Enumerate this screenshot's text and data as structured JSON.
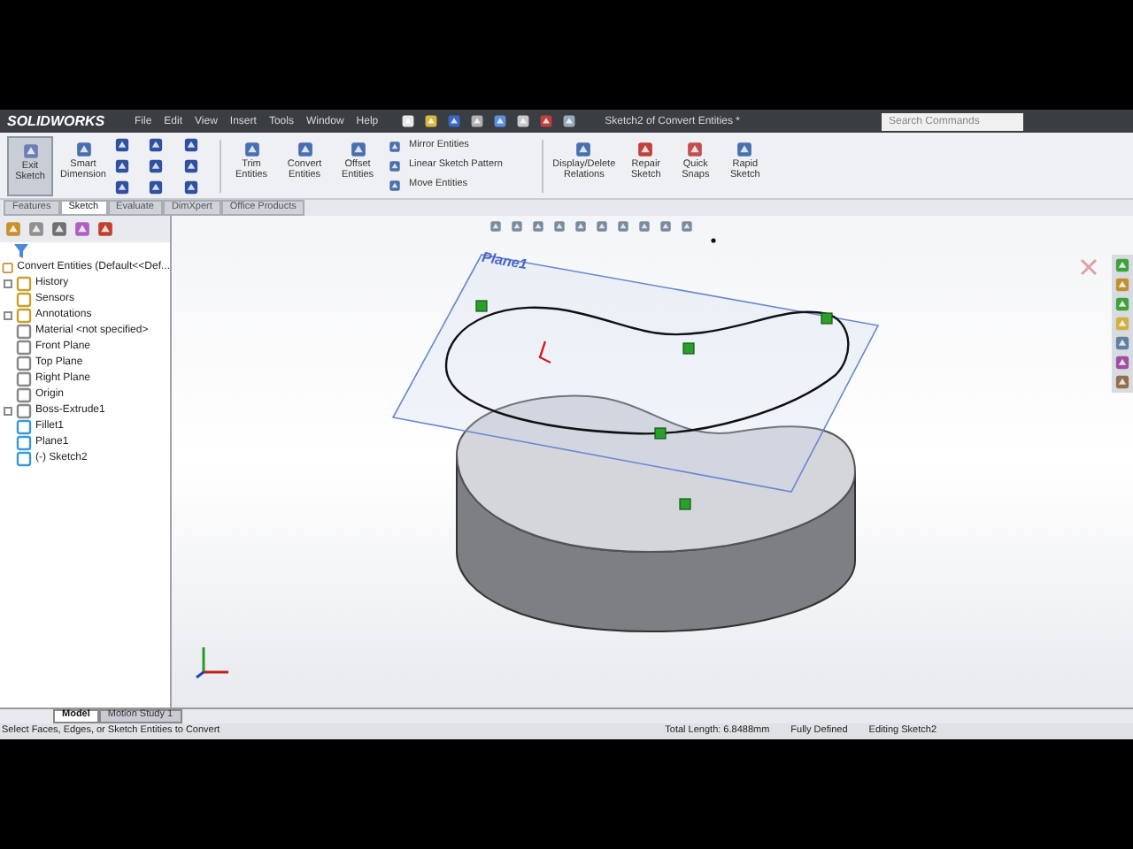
{
  "title_bar": {
    "logo": "SOLIDWORKS",
    "menu": [
      "File",
      "Edit",
      "View",
      "Insert",
      "Tools",
      "Window",
      "Help"
    ],
    "document_title": "Sketch2 of Convert Entities *",
    "search": {
      "placeholder": "Search Commands"
    }
  },
  "ribbon": {
    "large_tools": [
      {
        "label": "Exit Sketch",
        "selected": true
      },
      {
        "label": "Smart Dimension",
        "selected": false
      },
      {
        "label": "Trim Entities",
        "selected": false
      },
      {
        "label": "Convert Entities",
        "selected": false
      },
      {
        "label": "Offset Entities",
        "selected": false
      }
    ],
    "stacked_tools": [
      "Mirror Entities",
      "Linear Sketch Pattern",
      "Move Entities"
    ],
    "right_tools": [
      {
        "label": "Display/Delete Relations",
        "selected": false
      },
      {
        "label": "Repair Sketch",
        "selected": false
      },
      {
        "label": "Quick Snaps",
        "selected": false
      },
      {
        "label": "Rapid Sketch",
        "selected": false
      }
    ]
  },
  "command_tabs": [
    {
      "label": "Features",
      "selected": false
    },
    {
      "label": "Sketch",
      "selected": true
    },
    {
      "label": "Evaluate",
      "selected": false
    },
    {
      "label": "DimXpert",
      "selected": false
    },
    {
      "label": "Office Products",
      "selected": false
    }
  ],
  "feature_tree": {
    "root": "Convert Entities (Default<<Def...",
    "items": [
      {
        "label": "History",
        "expander": true
      },
      {
        "label": "Sensors",
        "expander": false
      },
      {
        "label": "Annotations",
        "expander": true
      },
      {
        "label": "Material <not specified>",
        "expander": false
      },
      {
        "label": "Front Plane",
        "expander": false
      },
      {
        "label": "Top Plane",
        "expander": false
      },
      {
        "label": "Right Plane",
        "expander": false
      },
      {
        "label": "Origin",
        "expander": false
      },
      {
        "label": "Boss-Extrude1",
        "expander": true
      },
      {
        "label": "Fillet1",
        "expander": false
      },
      {
        "label": "Plane1",
        "expander": false
      },
      {
        "label": "(-) Sketch2",
        "expander": false
      }
    ]
  },
  "viewport": {
    "plane_label": "Plane1"
  },
  "bottom_tabs": [
    {
      "label": "Model",
      "selected": true
    },
    {
      "label": "Motion Study 1",
      "selected": false
    }
  ],
  "status_bar": {
    "message": "Select Faces, Edges, or Sketch Entities to Convert",
    "total_length": "Total Length: 6.8488mm",
    "definition": "Fully Defined",
    "mode": "Editing Sketch2"
  }
}
